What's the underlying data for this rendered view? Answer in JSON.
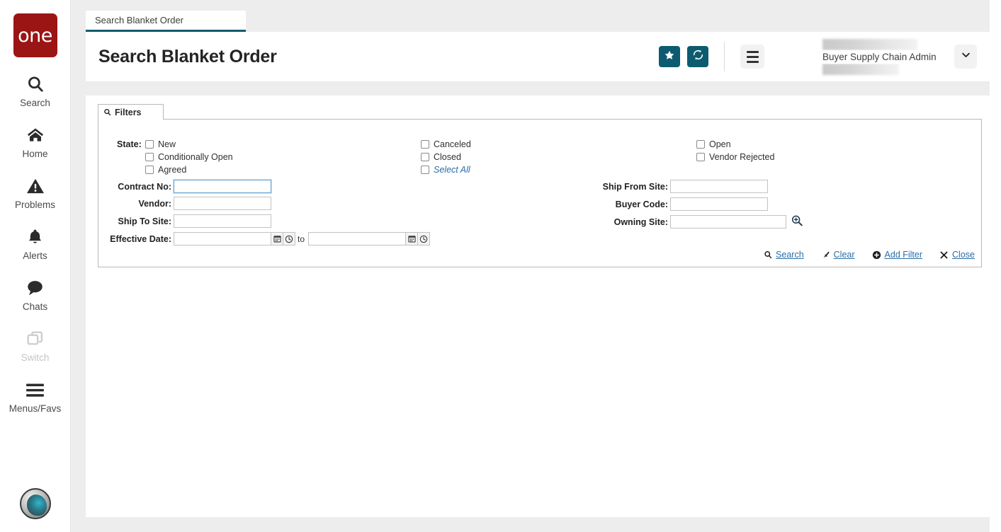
{
  "sidebar": {
    "logo_text": "one",
    "items": [
      {
        "label": "Search",
        "icon": "search-icon",
        "disabled": false
      },
      {
        "label": "Home",
        "icon": "home-icon",
        "disabled": false
      },
      {
        "label": "Problems",
        "icon": "warning-icon",
        "disabled": false
      },
      {
        "label": "Alerts",
        "icon": "bell-icon",
        "disabled": false
      },
      {
        "label": "Chats",
        "icon": "chat-icon",
        "disabled": false
      },
      {
        "label": "Switch",
        "icon": "switch-icon",
        "disabled": true
      },
      {
        "label": "Menus/Favs",
        "icon": "hamburger-icon",
        "disabled": false
      }
    ],
    "avatar_name": "user-avatar"
  },
  "tabstrip": {
    "active_tab_label": "Search Blanket Order"
  },
  "header": {
    "title": "Search Blanket Order",
    "favorite_button_icon": "star-icon",
    "refresh_button_icon": "refresh-icon",
    "menu_button_icon": "hamburger-icon",
    "user_role": "Buyer Supply Chain Admin",
    "user_caret_icon": "chevron-down-icon"
  },
  "filters": {
    "tab_label": "Filters",
    "tab_icon": "search-icon",
    "state_label": "State:",
    "state_options": [
      {
        "label": "New",
        "checked": false,
        "style": "normal"
      },
      {
        "label": "Conditionally Open",
        "checked": false,
        "style": "normal"
      },
      {
        "label": "Agreed",
        "checked": false,
        "style": "normal"
      },
      {
        "label": "Canceled",
        "checked": false,
        "style": "normal"
      },
      {
        "label": "Closed",
        "checked": false,
        "style": "normal"
      },
      {
        "label": "Select All",
        "checked": false,
        "style": "link"
      },
      {
        "label": "Open",
        "checked": false,
        "style": "normal"
      },
      {
        "label": "Vendor Rejected",
        "checked": false,
        "style": "normal"
      }
    ],
    "fields": {
      "contract_no": {
        "label": "Contract No:",
        "value": "",
        "placeholder": ""
      },
      "vendor": {
        "label": "Vendor:",
        "value": "",
        "placeholder": ""
      },
      "ship_to_site": {
        "label": "Ship To Site:",
        "value": "",
        "placeholder": ""
      },
      "effective_date": {
        "label": "Effective Date:",
        "from_value": "",
        "to_value": "",
        "separator": "to"
      },
      "ship_from_site": {
        "label": "Ship From Site:",
        "value": "",
        "placeholder": ""
      },
      "buyer_code": {
        "label": "Buyer Code:",
        "value": "",
        "placeholder": ""
      },
      "owning_site": {
        "label": "Owning Site:",
        "value": "",
        "placeholder": ""
      }
    },
    "actions": [
      {
        "label": "Search",
        "icon": "search-icon"
      },
      {
        "label": "Clear",
        "icon": "eraser-icon"
      },
      {
        "label": "Add Filter",
        "icon": "plus-circle-icon"
      },
      {
        "label": "Close",
        "icon": "close-icon"
      }
    ]
  },
  "colors": {
    "brand_red": "#9b1515",
    "accent_teal": "#0d5b70",
    "link_blue": "#2b6ea8",
    "page_bg": "#ededed",
    "panel_bg": "#ffffff",
    "border_gray": "#b8b8b8"
  }
}
